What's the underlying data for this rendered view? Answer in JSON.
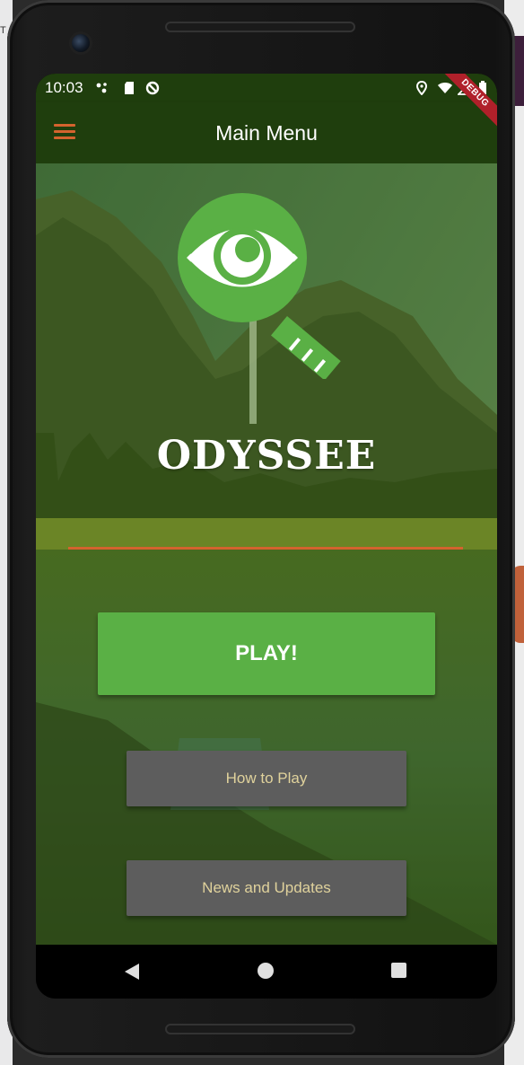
{
  "status_bar": {
    "time": "10:03",
    "icons": [
      "notification-dots-icon",
      "sd-card-icon",
      "blocked-icon",
      "location-icon",
      "wifi-icon",
      "signal-icon",
      "battery-icon"
    ]
  },
  "app_bar": {
    "title": "Main Menu",
    "menu_icon": "hamburger-icon",
    "debug_banner": "DEBUG"
  },
  "main": {
    "logo_icon": "magnifier-eye-icon",
    "brand": "ODYSSEE",
    "buttons": {
      "play": "PLAY!",
      "how_to_play": "How to Play",
      "news": "News and Updates"
    }
  },
  "nav_bar": {
    "back": "back-icon",
    "home": "home-icon",
    "recents": "recents-icon"
  },
  "colors": {
    "app_bar": "#1f3e0d",
    "accent_orange": "#d4632e",
    "play_green": "#5ab045",
    "grey_button": "#5d5d5d",
    "grey_button_text": "#e0d29c"
  }
}
